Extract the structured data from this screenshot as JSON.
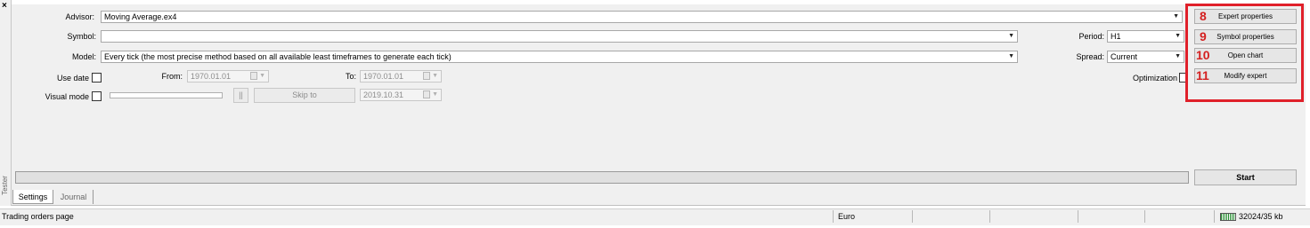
{
  "side_strip": {
    "close_glyph": "×",
    "label": "Tester"
  },
  "form": {
    "advisor_label": "Advisor:",
    "advisor_value": "Moving Average.ex4",
    "symbol_label": "Symbol:",
    "symbol_value": "",
    "model_label": "Model:",
    "model_value": "Every tick (the most precise method based on all available least timeframes to generate each tick)",
    "period_label": "Period:",
    "period_value": "H1",
    "spread_label": "Spread:",
    "spread_value": "Current",
    "use_date_label": "Use date",
    "from_label": "From:",
    "from_value": "1970.01.01",
    "to_label": "To:",
    "to_value": "1970.01.01",
    "visual_mode_label": "Visual mode",
    "pause_label": "||",
    "skip_to_label": "Skip to",
    "skip_date_value": "2019.10.31",
    "optimization_label": "Optimization"
  },
  "right_buttons": [
    {
      "number": "8",
      "label": "Expert properties"
    },
    {
      "number": "9",
      "label": "Symbol properties"
    },
    {
      "number": "10",
      "label": "Open chart"
    },
    {
      "number": "11",
      "label": "Modify expert"
    }
  ],
  "start_label": "Start",
  "tabs": [
    {
      "label": "Settings",
      "active": true
    },
    {
      "label": "Journal",
      "active": false
    }
  ],
  "status": {
    "left_text": "Trading orders page",
    "profile": "Euro",
    "traffic": "32024/35 kb"
  },
  "colors": {
    "highlight": "#e0202a",
    "number": "#d42020",
    "panel": "#f0f0f0"
  }
}
